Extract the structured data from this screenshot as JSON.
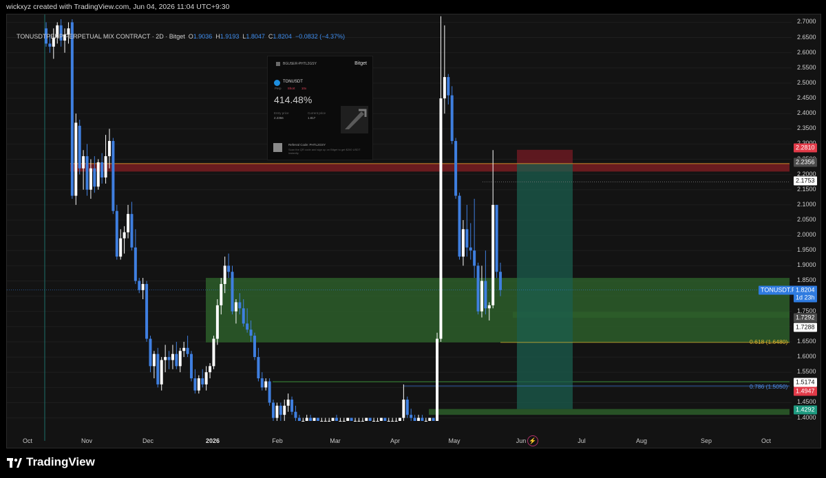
{
  "caption": "wickxyz created with TradingView.com, Jun 04, 2026 11:04 UTC+9:30",
  "legend": {
    "symbol": "TONUSDTPERP PERPETUAL MIX CONTRACT · 2D · Bitget",
    "o_label": "O",
    "o": "1.9036",
    "h_label": "H",
    "h": "1.9193",
    "l_label": "L",
    "l": "1.8047",
    "c_label": "C",
    "c": "1.8204",
    "change": "−0.0832 (−4.37%)"
  },
  "brand": "TradingView",
  "colors": {
    "background": "#131313",
    "up_candle": "#ffffff",
    "down_candle": "#3f7fe0",
    "demand_zone": "#2d5e2a",
    "supply_zone": "#7a1d22",
    "target_zone": "#1b5e4e",
    "stop_zone": "#6b1a22",
    "price_tag": "#2f7be0"
  },
  "share_card": {
    "username": "BGUSER-PHTL2GSY",
    "brand": "Bitget",
    "symbol": "TONUSDT",
    "perp": "Perp",
    "direction": "Short",
    "leverage": "10x",
    "pnl": "414.48%",
    "entry_label": "Entry price",
    "entry_value": "2.2356",
    "current_label": "Current price",
    "current_value": "1.817",
    "referral": "Referral Code: PHTL2GSY",
    "referral_desc": "Scan the QR code and sign up on Bitget to get $200 USDT instantly."
  },
  "price_tags": {
    "stop": "2.2810",
    "entry": "2.2356",
    "level": "2.1753",
    "symbol": "TONUSDT.P",
    "current": "1.8204",
    "countdown": "1d 23h",
    "level2": "1.7292",
    "level3": "1.7288",
    "fib618": "0.618 (1.6480)",
    "level4": "1.5174",
    "fib786": "0.786 (1.5050)",
    "level5": "1.4947",
    "target": "1.4292"
  },
  "chart_data": {
    "type": "candlestick",
    "timeframe": "2D",
    "x_ticks": [
      "Oct",
      "Nov",
      "Dec",
      "2026",
      "Feb",
      "Mar",
      "Apr",
      "May",
      "Jun",
      "Jul",
      "Aug",
      "Sep",
      "Oct"
    ],
    "y_ticks": [
      "2.7000",
      "2.6500",
      "2.6000",
      "2.5500",
      "2.5000",
      "2.4500",
      "2.4000",
      "2.3500",
      "2.3000",
      "2.2500",
      "2.2000",
      "2.1500",
      "2.1000",
      "2.0500",
      "2.0000",
      "1.9500",
      "1.9000",
      "1.8500",
      "1.8000",
      "1.7500",
      "1.7000",
      "1.6500",
      "1.6000",
      "1.5500",
      "1.5000",
      "1.4500",
      "1.4000"
    ],
    "ylim": [
      1.39,
      2.71
    ],
    "ohlc": [
      [
        2.68,
        2.7,
        2.62,
        2.63
      ],
      [
        2.63,
        2.66,
        2.6,
        2.62
      ],
      [
        2.62,
        2.68,
        2.58,
        2.65
      ],
      [
        2.65,
        2.7,
        2.63,
        2.69
      ],
      [
        2.69,
        2.71,
        2.62,
        2.64
      ],
      [
        2.64,
        2.68,
        2.6,
        2.66
      ],
      [
        2.66,
        2.7,
        2.63,
        2.68
      ],
      [
        2.7,
        2.71,
        2.12,
        2.13
      ],
      [
        2.13,
        2.4,
        2.1,
        2.37
      ],
      [
        2.36,
        2.38,
        2.2,
        2.22
      ],
      [
        2.22,
        2.28,
        2.15,
        2.26
      ],
      [
        2.26,
        2.3,
        2.13,
        2.15
      ],
      [
        2.15,
        2.25,
        2.12,
        2.22
      ],
      [
        2.22,
        2.26,
        2.14,
        2.16
      ],
      [
        2.16,
        2.25,
        2.15,
        2.24
      ],
      [
        2.24,
        2.27,
        2.17,
        2.19
      ],
      [
        2.19,
        2.33,
        2.17,
        2.26
      ],
      [
        2.26,
        2.35,
        2.22,
        2.31
      ],
      [
        2.31,
        2.32,
        2.07,
        2.08
      ],
      [
        2.08,
        2.1,
        1.92,
        1.93
      ],
      [
        1.93,
        2.02,
        1.92,
        1.99
      ],
      [
        1.99,
        2.03,
        1.94,
        2.01
      ],
      [
        2.01,
        2.1,
        1.99,
        2.07
      ],
      [
        2.07,
        2.11,
        1.95,
        1.96
      ],
      [
        1.96,
        2.02,
        1.84,
        1.85
      ],
      [
        1.85,
        1.86,
        1.81,
        1.82
      ],
      [
        1.82,
        1.86,
        1.79,
        1.84
      ],
      [
        1.84,
        1.85,
        1.65,
        1.66
      ],
      [
        1.66,
        1.67,
        1.55,
        1.57
      ],
      [
        1.57,
        1.62,
        1.53,
        1.61
      ],
      [
        1.61,
        1.63,
        1.5,
        1.51
      ],
      [
        1.51,
        1.6,
        1.49,
        1.59
      ],
      [
        1.59,
        1.64,
        1.55,
        1.6
      ],
      [
        1.6,
        1.62,
        1.56,
        1.59
      ],
      [
        1.59,
        1.64,
        1.56,
        1.61
      ],
      [
        1.61,
        1.65,
        1.56,
        1.57
      ],
      [
        1.57,
        1.63,
        1.55,
        1.62
      ],
      [
        1.62,
        1.65,
        1.6,
        1.63
      ],
      [
        1.63,
        1.67,
        1.6,
        1.61
      ],
      [
        1.61,
        1.62,
        1.52,
        1.53
      ],
      [
        1.53,
        1.56,
        1.48,
        1.49
      ],
      [
        1.49,
        1.54,
        1.48,
        1.53
      ],
      [
        1.53,
        1.56,
        1.5,
        1.51
      ],
      [
        1.51,
        1.57,
        1.49,
        1.55
      ],
      [
        1.55,
        1.58,
        1.53,
        1.57
      ],
      [
        1.57,
        1.67,
        1.56,
        1.66
      ],
      [
        1.66,
        1.79,
        1.64,
        1.77
      ],
      [
        1.77,
        1.86,
        1.74,
        1.84
      ],
      [
        1.84,
        1.93,
        1.81,
        1.9
      ],
      [
        1.9,
        1.94,
        1.86,
        1.88
      ],
      [
        1.88,
        1.9,
        1.74,
        1.75
      ],
      [
        1.75,
        1.79,
        1.71,
        1.78
      ],
      [
        1.78,
        1.81,
        1.74,
        1.76
      ],
      [
        1.76,
        1.79,
        1.7,
        1.71
      ],
      [
        1.71,
        1.76,
        1.68,
        1.69
      ],
      [
        1.69,
        1.72,
        1.65,
        1.67
      ],
      [
        1.67,
        1.68,
        1.59,
        1.6
      ],
      [
        1.6,
        1.63,
        1.52,
        1.53
      ],
      [
        1.53,
        1.55,
        1.49,
        1.5
      ],
      [
        1.5,
        1.53,
        1.49,
        1.52
      ],
      [
        1.52,
        1.53,
        1.44,
        1.45
      ],
      [
        1.45,
        1.46,
        1.39,
        1.4
      ],
      [
        1.4,
        1.45,
        1.39,
        1.44
      ],
      [
        1.44,
        1.45,
        1.39,
        1.41
      ],
      [
        1.41,
        1.46,
        1.39,
        1.44
      ],
      [
        1.44,
        1.48,
        1.42,
        1.46
      ],
      [
        1.46,
        1.47,
        1.41,
        1.42
      ],
      [
        1.42,
        1.44,
        1.39,
        1.4
      ],
      [
        1.4,
        1.41,
        1.39,
        1.39
      ],
      [
        1.39,
        1.4,
        1.39,
        1.39
      ],
      [
        1.39,
        1.41,
        1.39,
        1.4
      ],
      [
        1.4,
        1.41,
        1.39,
        1.39
      ],
      [
        1.39,
        1.4,
        1.39,
        1.4
      ],
      [
        1.4,
        1.4,
        1.39,
        1.39
      ],
      [
        1.39,
        1.4,
        1.39,
        1.39
      ],
      [
        1.39,
        1.4,
        1.39,
        1.39
      ],
      [
        1.39,
        1.4,
        1.39,
        1.39
      ],
      [
        1.39,
        1.4,
        1.39,
        1.4
      ],
      [
        1.4,
        1.41,
        1.39,
        1.39
      ],
      [
        1.39,
        1.4,
        1.39,
        1.39
      ],
      [
        1.39,
        1.4,
        1.39,
        1.39
      ],
      [
        1.39,
        1.4,
        1.39,
        1.4
      ],
      [
        1.4,
        1.4,
        1.39,
        1.39
      ],
      [
        1.39,
        1.4,
        1.39,
        1.39
      ],
      [
        1.39,
        1.4,
        1.39,
        1.39
      ],
      [
        1.39,
        1.4,
        1.39,
        1.39
      ],
      [
        1.39,
        1.4,
        1.39,
        1.4
      ],
      [
        1.4,
        1.4,
        1.39,
        1.39
      ],
      [
        1.39,
        1.4,
        1.39,
        1.39
      ],
      [
        1.39,
        1.4,
        1.39,
        1.39
      ],
      [
        1.39,
        1.4,
        1.39,
        1.4
      ],
      [
        1.4,
        1.4,
        1.39,
        1.39
      ],
      [
        1.39,
        1.4,
        1.39,
        1.39
      ],
      [
        1.39,
        1.4,
        1.39,
        1.39
      ],
      [
        1.39,
        1.4,
        1.39,
        1.39
      ],
      [
        1.39,
        1.4,
        1.39,
        1.4
      ],
      [
        1.4,
        1.51,
        1.39,
        1.46
      ],
      [
        1.46,
        1.47,
        1.4,
        1.41
      ],
      [
        1.41,
        1.43,
        1.39,
        1.4
      ],
      [
        1.4,
        1.41,
        1.39,
        1.39
      ],
      [
        1.39,
        1.41,
        1.39,
        1.4
      ],
      [
        1.4,
        1.41,
        1.39,
        1.39
      ],
      [
        1.39,
        1.4,
        1.39,
        1.39
      ],
      [
        1.39,
        1.4,
        1.39,
        1.4
      ],
      [
        1.4,
        1.4,
        1.39,
        1.39
      ],
      [
        1.39,
        1.68,
        1.39,
        1.66
      ],
      [
        1.66,
        2.72,
        1.65,
        2.45
      ],
      [
        2.45,
        2.69,
        2.4,
        2.52
      ],
      [
        2.52,
        2.53,
        2.43,
        2.46
      ],
      [
        2.46,
        2.49,
        2.3,
        2.31
      ],
      [
        2.31,
        2.32,
        2.12,
        2.13
      ],
      [
        2.13,
        2.14,
        1.92,
        1.93
      ],
      [
        1.93,
        2.05,
        1.9,
        2.02
      ],
      [
        2.02,
        2.1,
        1.93,
        1.96
      ],
      [
        1.96,
        2.04,
        1.92,
        1.95
      ],
      [
        1.95,
        2.12,
        1.86,
        1.9
      ],
      [
        1.9,
        1.91,
        1.74,
        1.75
      ],
      [
        1.75,
        1.9,
        1.73,
        1.85
      ],
      [
        1.85,
        1.95,
        1.74,
        1.76
      ],
      [
        1.76,
        1.78,
        1.72,
        1.77
      ],
      [
        1.77,
        2.28,
        1.76,
        2.1
      ],
      [
        2.1,
        2.1,
        1.86,
        1.88
      ],
      [
        1.88,
        1.91,
        1.8,
        1.82
      ]
    ],
    "zones": [
      {
        "type": "supply",
        "y_range": [
          2.2095,
          2.2356
        ]
      },
      {
        "type": "demand",
        "y_range": [
          1.648,
          1.86
        ]
      },
      {
        "type": "demand",
        "y_range": [
          1.7292,
          1.748
        ]
      },
      {
        "type": "demand",
        "y_range": [
          1.5174,
          1.521
        ]
      },
      {
        "type": "demand",
        "y_range": [
          1.41,
          1.4292
        ]
      },
      {
        "type": "stop",
        "y_range": [
          2.2356,
          2.281
        ]
      },
      {
        "type": "target",
        "y_range": [
          1.4292,
          2.2356
        ]
      }
    ],
    "position": {
      "direction": "short",
      "entry": 2.2356,
      "stop": 2.281,
      "target": 1.4292
    },
    "levels": [
      2.1753,
      1.7288,
      1.648,
      1.505
    ]
  }
}
